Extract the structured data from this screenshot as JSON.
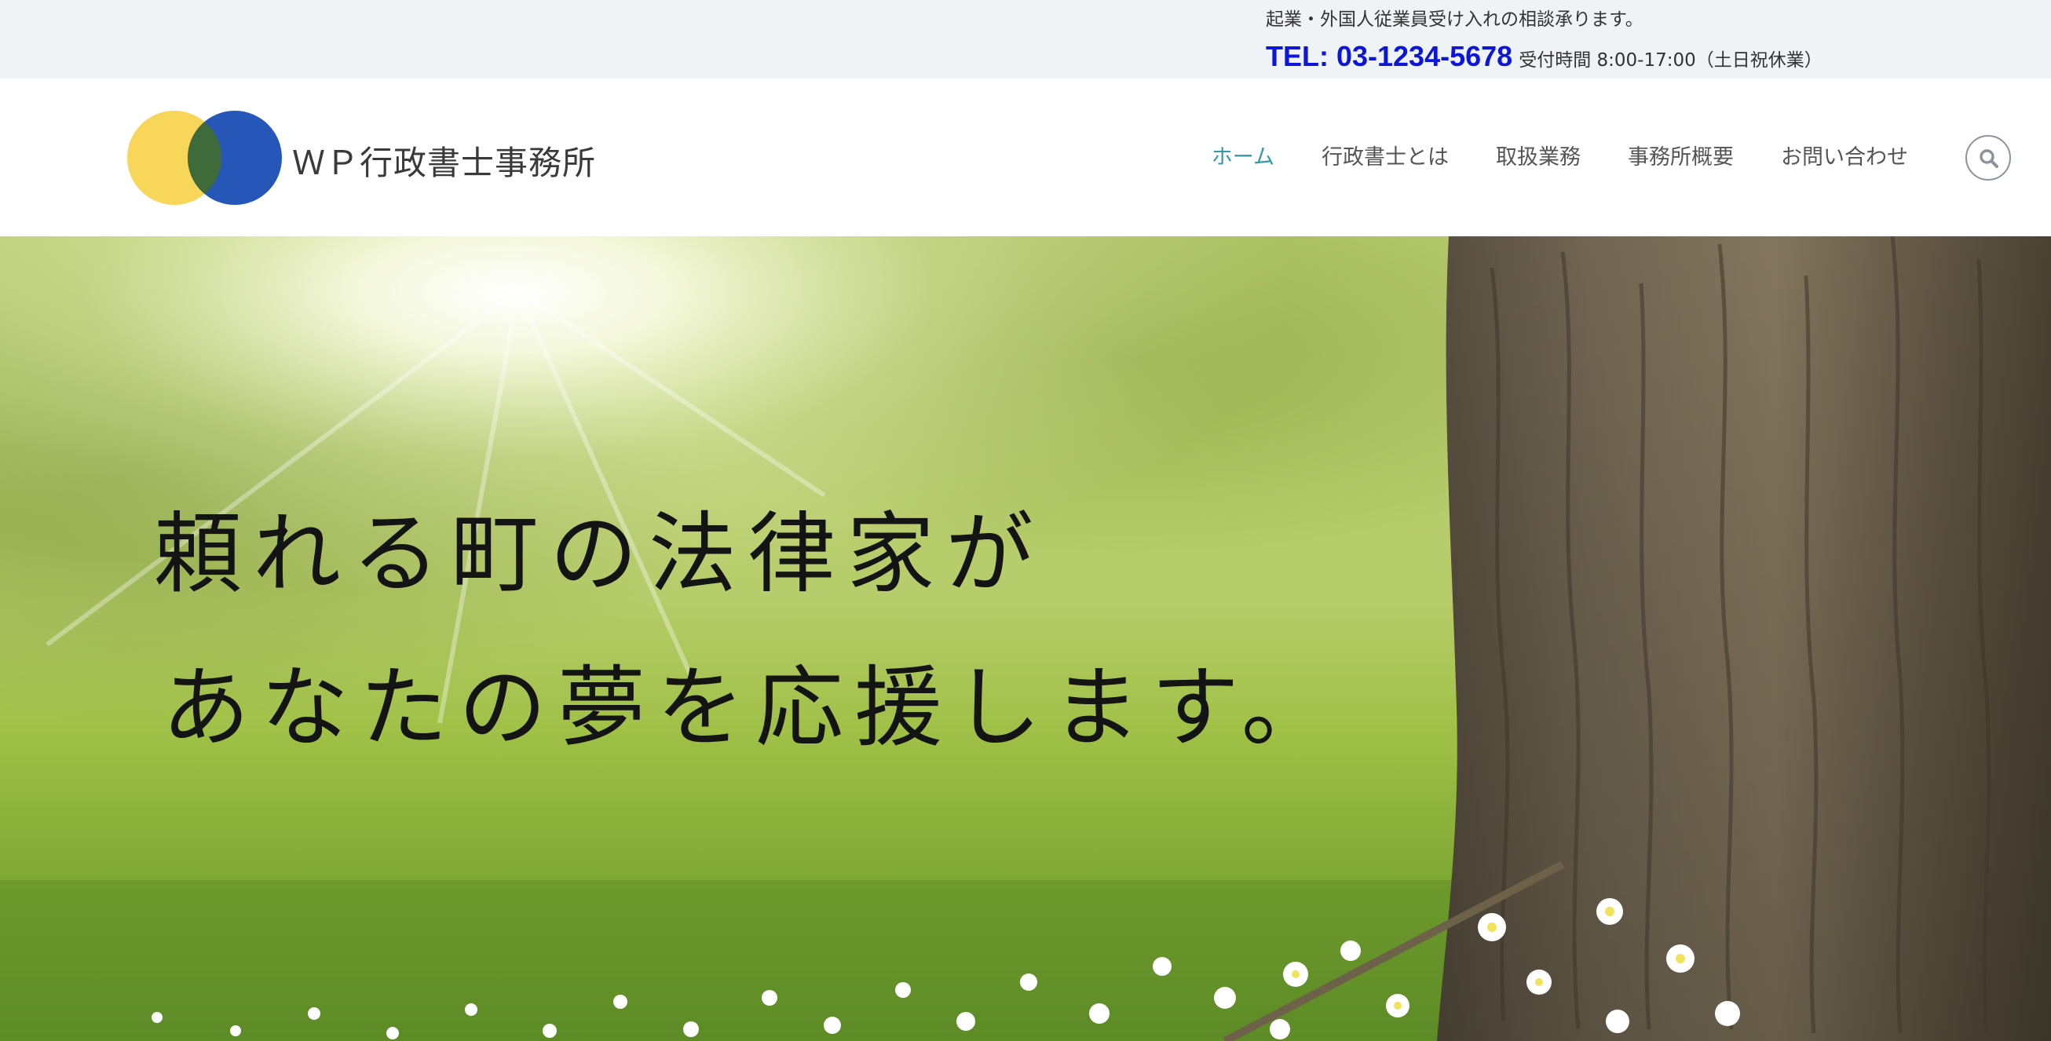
{
  "topbar": {
    "tagline": "起業・外国人従業員受け入れの相談承ります。",
    "phone": "TEL: 03-1234-5678",
    "hours": "受付時間 8:00-17:00（土日祝休業）"
  },
  "header": {
    "logo_text": "ＷＰ行政書士事務所",
    "logo_icon": "overlapping-circles-logo",
    "nav": {
      "home": "ホーム",
      "about": "行政書士とは",
      "services": "取扱業務",
      "office": "事務所概要",
      "contact": "お問い合わせ"
    },
    "search_icon": "search-icon"
  },
  "hero": {
    "line1": "頼れる町の法律家が",
    "line2": "あなたの夢を応援します。"
  },
  "colors": {
    "topbar_bg": "#eff3f6",
    "phone": "#0d16d8",
    "nav_active": "#2f9ba8",
    "nav_text": "#555555",
    "logo_yellow": "#f7d659",
    "logo_blue": "#2556b8"
  }
}
